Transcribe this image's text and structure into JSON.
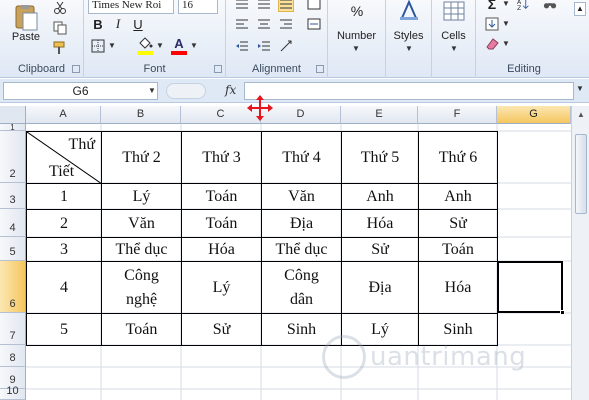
{
  "ribbon": {
    "clipboard": {
      "paste_label": "Paste",
      "group_label": "Clipboard"
    },
    "font": {
      "font_name": "Times New Roi",
      "font_size": "16",
      "group_label": "Font",
      "bold": "B",
      "italic": "I",
      "underline": "U"
    },
    "alignment": {
      "group_label": "Alignment"
    },
    "number": {
      "percent": "%",
      "label": "Number"
    },
    "styles": {
      "label": "Styles"
    },
    "cells": {
      "label": "Cells"
    },
    "editing": {
      "group_label": "Editing",
      "sigma": "Σ"
    },
    "colors": {
      "fill": "#ffff00",
      "font_color": "#ff0000",
      "accent": "#2b579a"
    }
  },
  "formula_bar": {
    "name_box": "G6",
    "fx": "fx",
    "formula": ""
  },
  "columns": [
    "A",
    "B",
    "C",
    "D",
    "E",
    "F",
    "G"
  ],
  "rows": [
    "1",
    "2",
    "3",
    "4",
    "5",
    "6",
    "7",
    "8",
    "9",
    "10"
  ],
  "selected_cell": {
    "column": "G",
    "row": "6"
  },
  "timetable": {
    "corner_top": "Thứ",
    "corner_bottom": "Tiết",
    "days": [
      "Thứ 2",
      "Thứ 3",
      "Thứ 4",
      "Thứ 5",
      "Thứ 6"
    ],
    "periods": [
      {
        "period": "1",
        "subjects": [
          "Lý",
          "Toán",
          "Văn",
          "Anh",
          "Anh"
        ]
      },
      {
        "period": "2",
        "subjects": [
          "Văn",
          "Toán",
          "Địa",
          "Hóa",
          "Sử"
        ]
      },
      {
        "period": "3",
        "subjects": [
          "Thể dục",
          "Hóa",
          "Thể dục",
          "Sử",
          "Toán"
        ]
      },
      {
        "period": "4",
        "subjects": [
          "Công nghệ",
          "Lý",
          "Công dân",
          "Địa",
          "Hóa"
        ]
      },
      {
        "period": "5",
        "subjects": [
          "Toán",
          "Sử",
          "Sinh",
          "Lý",
          "Sinh"
        ]
      }
    ]
  },
  "watermark": "uantrimang"
}
